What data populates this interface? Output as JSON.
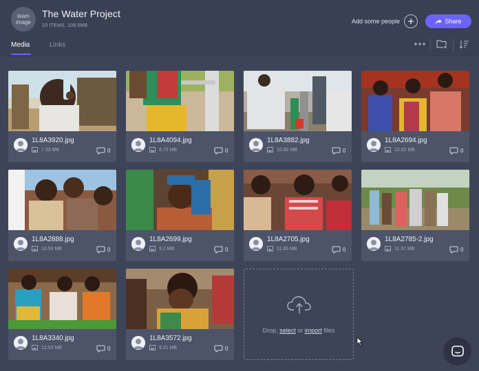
{
  "header": {
    "team_avatar_line1": "team",
    "team_avatar_line2": "image",
    "title": "The Water Project",
    "meta": "10 ITEMS, 108.5MB",
    "add_people_label": "Add some people",
    "add_icon": "plus-icon",
    "share_label": "Share",
    "share_icon": "share-arrow-icon",
    "accent_color": "#6c63ff"
  },
  "tabs": [
    {
      "label": "Media",
      "active": true
    },
    {
      "label": "Links",
      "active": false
    }
  ],
  "toolbar": {
    "icons": [
      "more-icon",
      "new-folder-icon",
      "sort-icon"
    ]
  },
  "files": [
    {
      "name": "1L8A3920.jpg",
      "size": "7.33 MB",
      "comments": "0"
    },
    {
      "name": "1L8A4094.jpg",
      "size": "8.72 MB",
      "comments": "0"
    },
    {
      "name": "1L8A3882.jpg",
      "size": "10.82 MB",
      "comments": "0"
    },
    {
      "name": "1L8A2694.jpg",
      "size": "12.62 MB",
      "comments": "0"
    },
    {
      "name": "1L8A2888.jpg",
      "size": "10.53 MB",
      "comments": "0"
    },
    {
      "name": "1L8A2699.jpg",
      "size": "9.2 MB",
      "comments": "0"
    },
    {
      "name": "1L8A2705.jpg",
      "size": "11.66 MB",
      "comments": "0"
    },
    {
      "name": "1L8A2785-2.jpg",
      "size": "11.37 MB",
      "comments": "0"
    },
    {
      "name": "1L8A3340.jpg",
      "size": "12.03 MB",
      "comments": "0"
    },
    {
      "name": "1L8A3572.jpg",
      "size": "9.21 MB",
      "comments": "0"
    }
  ],
  "dropzone": {
    "icon": "cloud-upload-icon",
    "prefix": "Drop,",
    "select": "select",
    "middle": "or",
    "import": "import",
    "suffix": "files"
  },
  "chat_icon": "chat-bubble-icon"
}
